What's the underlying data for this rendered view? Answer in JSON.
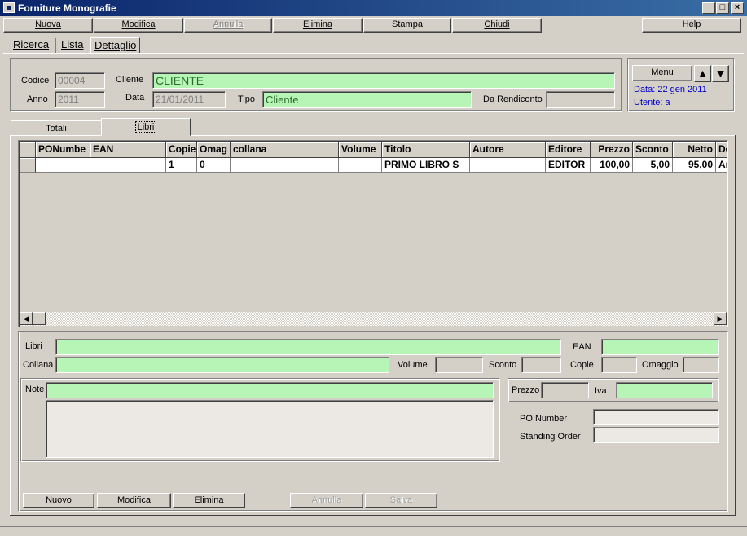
{
  "window": {
    "title": "Forniture Monografie",
    "minimize_icon": "minimize-icon",
    "maximize_icon": "maximize-icon",
    "close_icon": "close-icon"
  },
  "menubar": {
    "nuova": "Nuova",
    "modifica": "Modifica",
    "annulla": "Annulla",
    "elimina": "Elimina",
    "stampa": "Stampa",
    "chiudi": "Chiudi",
    "help": "Help"
  },
  "view_tabs": [
    "Ricerca",
    "Lista",
    "Dettaglio"
  ],
  "header": {
    "codice_label": "Codice",
    "codice_value": "00004",
    "anno_label": "Anno",
    "anno_value": "2011",
    "cliente_label": "Cliente",
    "cliente_value": "CLIENTE",
    "data_label": "Data",
    "data_value": "21/01/2011",
    "tipo_label": "Tipo",
    "tipo_value": "Cliente",
    "rendiconto_label": "Da Rendiconto",
    "rendiconto_value": ""
  },
  "side_panel": {
    "menu_label": "Menu",
    "up_icon": "arrow-up-icon",
    "down_icon": "arrow-down-icon",
    "data_info": "Data: 22 gen 2011",
    "utente_info": "Utente: a"
  },
  "inner_tabs": [
    "Totali",
    "Libri"
  ],
  "grid": {
    "columns": [
      "",
      "PONumbe",
      "EAN",
      "Copie",
      "Omag",
      "collana",
      "Volume",
      "Titolo",
      "Autore",
      "Editore",
      "Prezzo",
      "Sconto",
      "Netto",
      "De"
    ],
    "rows": [
      [
        "",
        "",
        "",
        "1",
        "0",
        "",
        "",
        "PRIMO LIBRO S",
        "",
        "EDITOR",
        "100,00",
        "5,00",
        "95,00",
        "Ar"
      ]
    ]
  },
  "detail": {
    "libri_label": "Libri",
    "libri_value": "",
    "ean_label": "EAN",
    "ean_value": "",
    "collana_label": "Collana",
    "collana_value": "",
    "volume_label": "Volume",
    "sconto_label": "Sconto",
    "copie_label": "Copie",
    "omaggio_label": "Omaggio",
    "note_label": "Note",
    "prezzo_label": "Prezzo",
    "iva_label": "Iva",
    "ponumber_label": "PO Number",
    "standing_label": "Standing Order"
  },
  "bottom_buttons": {
    "nuovo": "Nuovo",
    "modifica": "Modifica",
    "elimina": "Elimina",
    "annulla": "Annulla",
    "salva": "Salva"
  },
  "colors": {
    "window_bg": "#d4d0c8",
    "title_bar": "#0a246a",
    "field_green": "#b6f5b6",
    "info_blue": "#0000cc"
  }
}
